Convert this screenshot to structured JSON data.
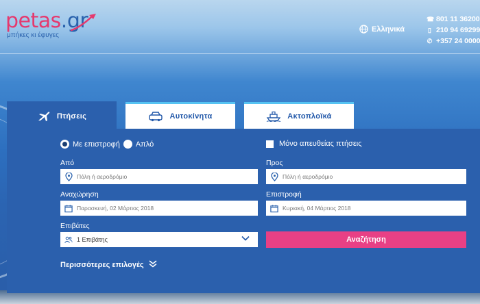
{
  "header": {
    "logo": {
      "word_main": "petas",
      "word_dot": ".gr",
      "tagline": "μπήκες κι έφυγες"
    },
    "language": "Ελληνικά",
    "contacts": [
      {
        "icon": "phone-icon",
        "text": "801 11 36200"
      },
      {
        "icon": "mobile-icon",
        "text": "210 94 69299"
      },
      {
        "icon": "handset-icon",
        "text": "+357 24 0000"
      }
    ]
  },
  "tabs": [
    {
      "icon": "plane-icon",
      "label": "Πτήσεις",
      "active": true
    },
    {
      "icon": "car-icon",
      "label": "Αυτοκίνητα",
      "active": false
    },
    {
      "icon": "ship-icon",
      "label": "Ακτοπλοϊκά",
      "active": false
    }
  ],
  "form": {
    "trip_type": {
      "round_trip": "Με επιστροφή",
      "one_way": "Απλό",
      "selected": "round_trip"
    },
    "direct_only": {
      "label": "Μόνο απευθείας πτήσεις",
      "checked": false
    },
    "from": {
      "label": "Από",
      "placeholder": "Πόλη ή αεροδρόμιο"
    },
    "to": {
      "label": "Προς",
      "placeholder": "Πόλη ή αεροδρόμιο"
    },
    "departure": {
      "label": "Αναχώρηση",
      "value": "Παρασκευή, 02 Μάρτιος 2018"
    },
    "return": {
      "label": "Επιστροφή",
      "value": "Κυριακή, 04 Μάρτιος 2018"
    },
    "passengers": {
      "label": "Επιβάτες",
      "value": "1 Επιβάτης"
    },
    "search_label": "Αναζήτηση",
    "more_options": "Περισσότερες επιλογές"
  },
  "colors": {
    "brand_pink": "#e5396e",
    "brand_blue": "#2a62ad",
    "panel_blue": "#2b60ad",
    "tab_accent": "#56c3f2",
    "search_button": "#e84085"
  }
}
